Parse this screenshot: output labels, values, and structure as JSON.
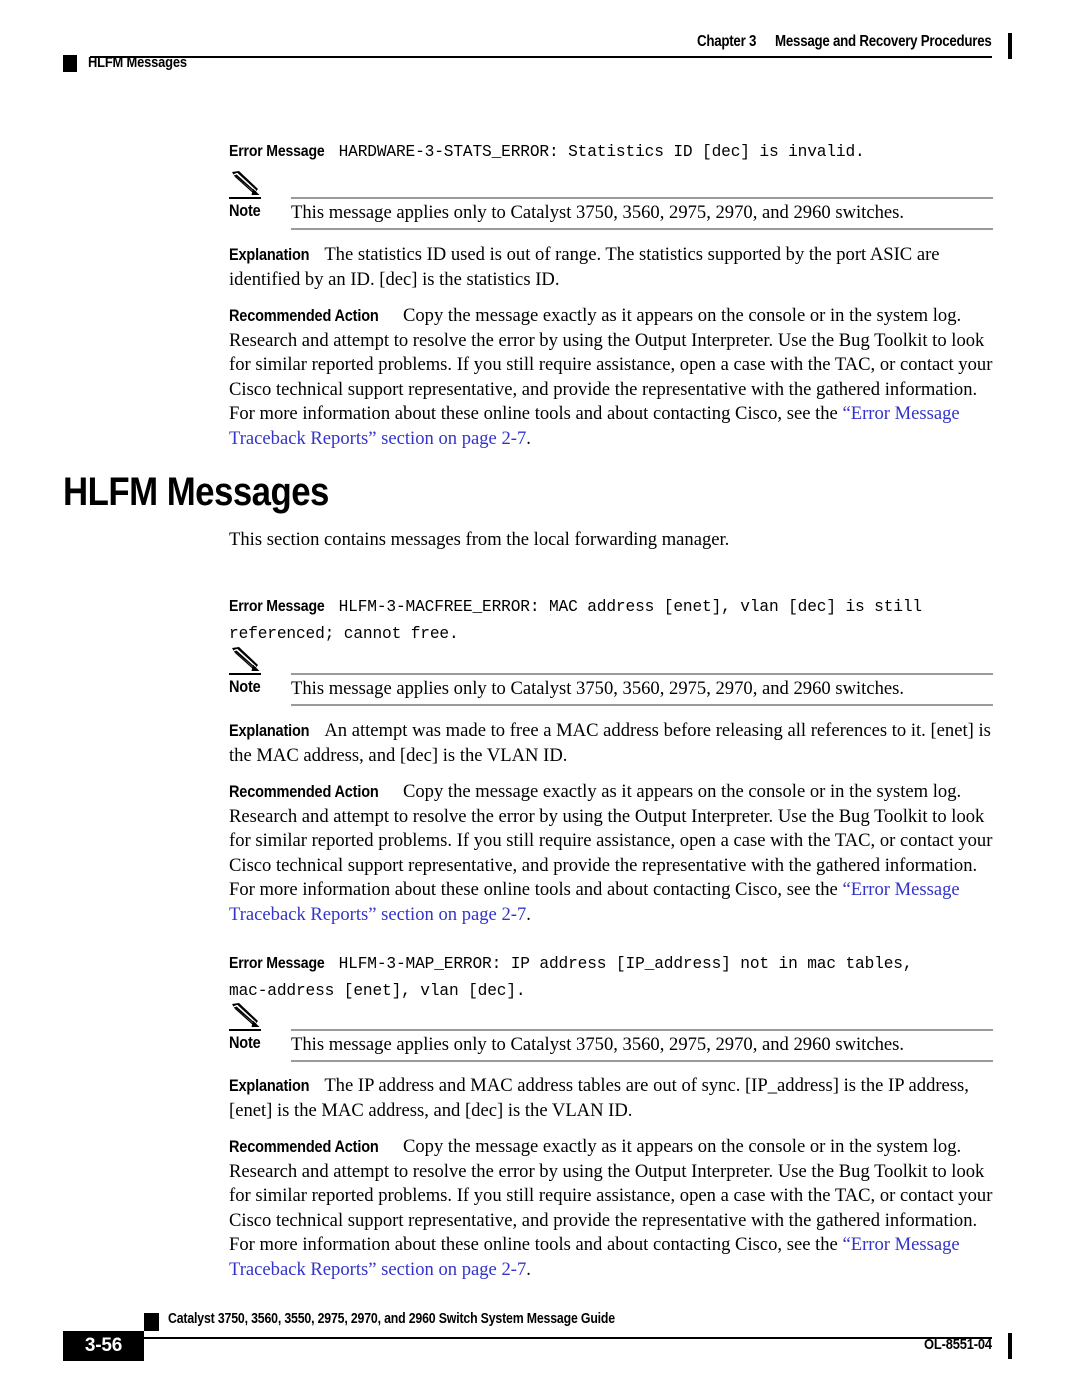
{
  "header": {
    "chapter": "Chapter 3",
    "chapter_title": "Message and Recovery Procedures",
    "section": "HLFM Messages"
  },
  "labels": {
    "error_message": "Error Message",
    "explanation": "Explanation",
    "recommended_action": "Recommended Action",
    "note": "Note"
  },
  "heading": {
    "title": "HLFM Messages"
  },
  "section_intro": "This section contains messages from the local forwarding manager.",
  "note_text": "This message applies only to Catalyst 3750, 3560, 2975, 2970, and 2960 switches.",
  "recommended_action_body_1": "Copy the message exactly as it appears on the console or in the system log. Research and attempt to resolve the error by using the Output Interpreter. Use the Bug Toolkit to look for similar reported problems. If you still require assistance, open a case with the TAC, or contact your Cisco technical support representative, and provide the representative with the gathered information. For more information about these online tools and about contacting Cisco, see the ",
  "recommended_action_xref": "“Error Message Traceback Reports” section on page 2-7",
  "recommended_action_body_2": ".",
  "messages": [
    {
      "id": "hardware-3-stats-error",
      "code": "HARDWARE-3-STATS_ERROR: Statistics ID [dec] is invalid.",
      "explanation": "The statistics ID used is out of range. The statistics supported by the port ASIC are identified by an ID. [dec] is the statistics ID."
    },
    {
      "id": "hlfm-3-macfree-error",
      "code": "HLFM-3-MACFREE_ERROR: MAC address [enet], vlan [dec] is still\nreferenced; cannot free.",
      "explanation": "An attempt was made to free a MAC address before releasing all references to it. [enet] is the MAC address, and [dec] is the VLAN ID."
    },
    {
      "id": "hlfm-3-map-error",
      "code": "HLFM-3-MAP_ERROR: IP address [IP_address] not in mac tables,\nmac-address [enet], vlan [dec].",
      "explanation": "The IP address and MAC address tables are out of sync. [IP_address] is the IP address, [enet] is the MAC address, and [dec] is the VLAN ID."
    }
  ],
  "footer": {
    "page_number": "3-56",
    "doc_title": "Catalyst 3750, 3560, 3550, 2975, 2970, and 2960 Switch System Message Guide",
    "doc_id": "OL-8551-04"
  },
  "colors": {
    "xref_blue": "#3333cc",
    "rule_gray": "#9a9a9a",
    "ink": "#000000"
  }
}
